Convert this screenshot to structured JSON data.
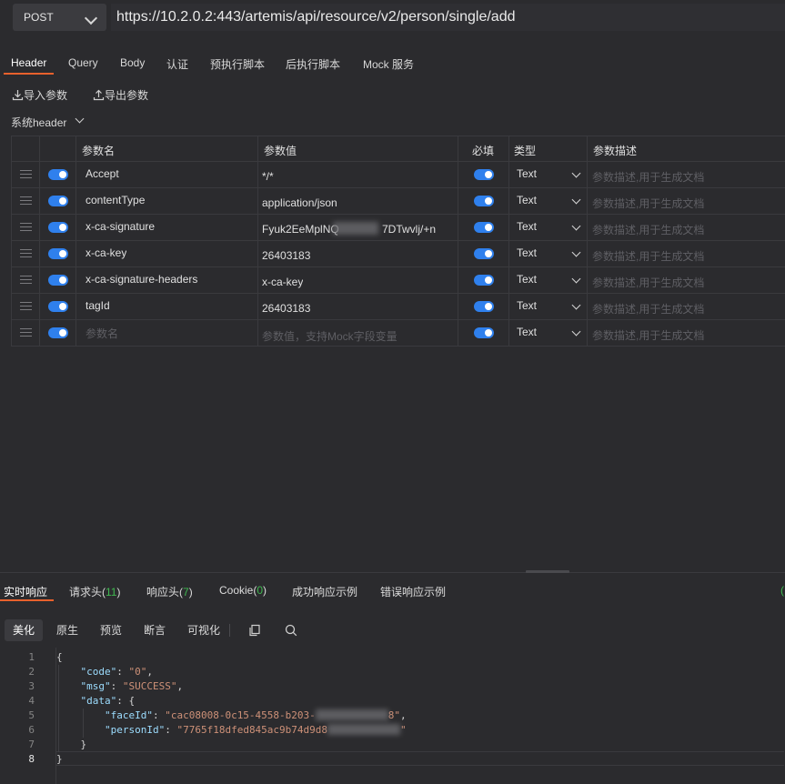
{
  "request": {
    "method": "POST",
    "url": "https://10.2.0.2:443/artemis/api/resource/v2/person/single/add"
  },
  "request_tabs": [
    "Header",
    "Query",
    "Body",
    "认证",
    "预执行脚本",
    "后执行脚本",
    "Mock 服务"
  ],
  "active_request_tab": "Header",
  "tools": {
    "import": "导入参数",
    "export": "导出参数"
  },
  "section": {
    "system_header": "系统header"
  },
  "table": {
    "headers": {
      "name": "参数名",
      "value": "参数值",
      "required": "必填",
      "type": "类型",
      "desc": "参数描述"
    },
    "desc_placeholder": "参数描述,用于生成文档",
    "rows": [
      {
        "name": "Accept",
        "value": "*/*",
        "type": "Text"
      },
      {
        "name": "contentType",
        "value": "application/json",
        "type": "Text"
      },
      {
        "name": "x-ca-signature",
        "value": "Fyuk2EeMplNQ",
        "value_tail": "7DTwvlj/+n",
        "type": "Text"
      },
      {
        "name": "x-ca-key",
        "value": "26403183",
        "type": "Text"
      },
      {
        "name": "x-ca-signature-headers",
        "value": "x-ca-key",
        "type": "Text"
      },
      {
        "name": "tagId",
        "value": "26403183",
        "type": "Text"
      }
    ],
    "new_row": {
      "name_placeholder": "参数名",
      "value_placeholder": "参数值，支持Mock字段变量",
      "type": "Text"
    }
  },
  "response_tabs": {
    "realtime": "实时响应",
    "req_headers": "请求头(",
    "req_headers_count": "11",
    "resp_headers": "响应头(",
    "resp_headers_count": "7",
    "cookie": "Cookie(",
    "cookie_count": "0",
    "close_paren": ")",
    "success_example": "成功响应示例",
    "error_example": "错误响应示例"
  },
  "view_modes": [
    "美化",
    "原生",
    "预览",
    "断言",
    "可视化"
  ],
  "code": {
    "line_numbers": [
      "1",
      "2",
      "3",
      "4",
      "5",
      "6",
      "7",
      "8"
    ],
    "brace_open": "{",
    "brace_close": "}",
    "code_key": "\"code\"",
    "code_val": "\"0\"",
    "msg_key": "\"msg\"",
    "msg_val": "\"SUCCESS\"",
    "data_key": "\"data\"",
    "faceId_key": "\"faceId\"",
    "faceId_val": "\"cac08008-0c15-4558-b203-",
    "faceId_tail": "8\"",
    "personId_key": "\"personId\"",
    "personId_val": "\"7765f18dfed845ac9b74d9d8",
    "personId_tail": "\""
  }
}
